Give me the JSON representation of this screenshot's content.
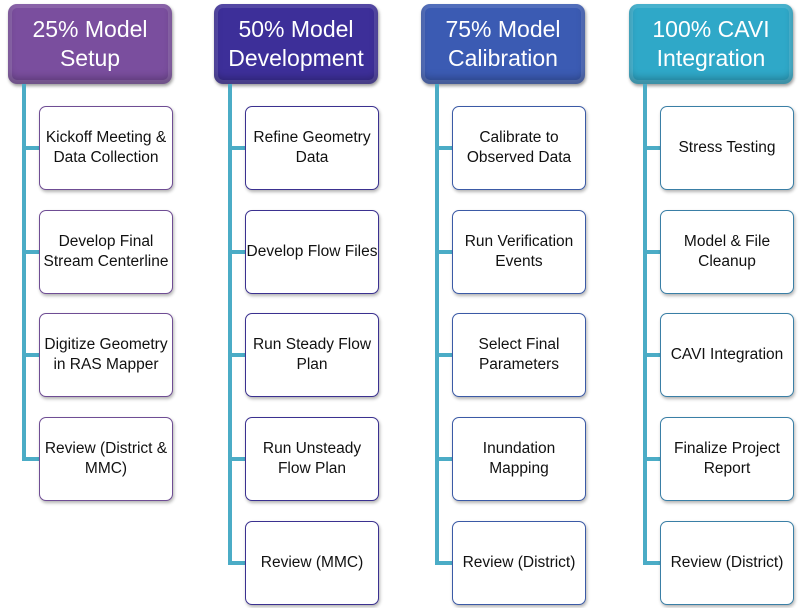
{
  "columns": [
    {
      "title": "25% Model Setup",
      "color": "#7a4e9e",
      "border": "#6f4d94",
      "items": [
        "Kickoff Meeting & Data Collection",
        "Develop Final Stream Centerline",
        "Digitize Geometry in RAS Mapper",
        "Review (District & MMC)"
      ]
    },
    {
      "title": "50% Model Development",
      "color": "#3d2f99",
      "border": "#3b3190",
      "items": [
        "Refine Geometry Data",
        "Develop Flow Files",
        "Run Steady Flow Plan",
        "Run Unsteady Flow Plan",
        "Review (MMC)"
      ]
    },
    {
      "title": "75% Model Calibration",
      "color": "#3b5bb3",
      "border": "#3b5aa6",
      "items": [
        "Calibrate to Observed Data",
        "Run Verification Events",
        "Select Final Parameters",
        "Inundation Mapping",
        "Review (District)"
      ]
    },
    {
      "title": "100% CAVI Integration",
      "color": "#2fa8c8",
      "border": "#3a7fa6",
      "items": [
        "Stress Testing",
        "Model & File Cleanup",
        "CAVI Integration",
        "Finalize Project Report",
        "Review (District)"
      ]
    }
  ],
  "connector_color": "#4bacc6"
}
